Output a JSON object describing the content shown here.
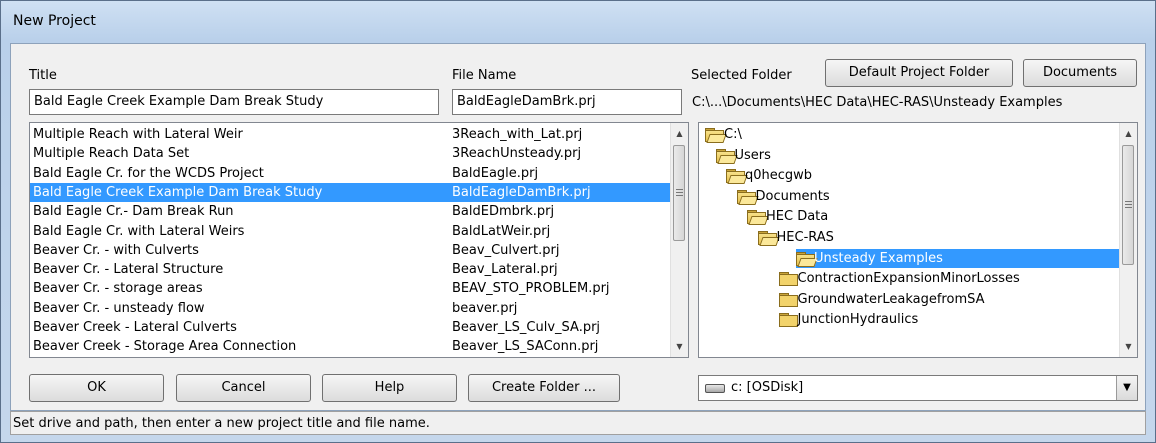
{
  "window": {
    "title": "New Project"
  },
  "labels": {
    "title": "Title",
    "file_name": "File Name",
    "selected_folder": "Selected Folder",
    "selected_folder_path": "C:\\...\\Documents\\HEC Data\\HEC-RAS\\Unsteady Examples"
  },
  "inputs": {
    "title_value": "Bald Eagle Creek Example Dam Break Study",
    "file_name_value": "BaldEagleDamBrk.prj"
  },
  "buttons": {
    "default_project_folder": "Default Project Folder",
    "documents": "Documents",
    "ok": "OK",
    "cancel": "Cancel",
    "help": "Help",
    "create_folder": "Create Folder ..."
  },
  "projects": [
    {
      "title": "Multiple Reach with Lateral Weir",
      "file": "3Reach_with_Lat.prj"
    },
    {
      "title": "Multiple Reach Data Set",
      "file": "3ReachUnsteady.prj"
    },
    {
      "title": "Bald Eagle Cr. for the WCDS Project",
      "file": "BaldEagle.prj"
    },
    {
      "title": "Bald Eagle Creek Example Dam Break Study",
      "file": "BaldEagleDamBrk.prj",
      "selected": true
    },
    {
      "title": "Bald Eagle Cr.- Dam Break Run",
      "file": "BaldEDmbrk.prj"
    },
    {
      "title": "Bald Eagle Cr. with Lateral Weirs",
      "file": "BaldLatWeir.prj"
    },
    {
      "title": "Beaver Cr. - with Culverts",
      "file": "Beav_Culvert.prj"
    },
    {
      "title": "Beaver Cr. - Lateral Structure",
      "file": "Beav_Lateral.prj"
    },
    {
      "title": "Beaver Cr. - storage areas",
      "file": "BEAV_STO_PROBLEM.prj"
    },
    {
      "title": "Beaver Cr. - unsteady flow",
      "file": "beaver.prj"
    },
    {
      "title": "Beaver Creek - Lateral Culverts",
      "file": "Beaver_LS_Culv_SA.prj"
    },
    {
      "title": "Beaver Creek - Storage Area Connection",
      "file": "Beaver_LS_SAConn.prj"
    }
  ],
  "folders": [
    {
      "name": "C:\\",
      "level": 0,
      "open": true
    },
    {
      "name": "Users",
      "level": 1,
      "open": true
    },
    {
      "name": "q0hecgwb",
      "level": 2,
      "open": true
    },
    {
      "name": "Documents",
      "level": 3,
      "open": true
    },
    {
      "name": "HEC Data",
      "level": 4,
      "open": true
    },
    {
      "name": "HEC-RAS",
      "level": 5,
      "open": true
    },
    {
      "name": "Unsteady Examples",
      "level": 6,
      "open": true,
      "selected": true
    },
    {
      "name": "ContractionExpansionMinorLosses",
      "level": 7,
      "open": false
    },
    {
      "name": "GroundwaterLeakagefromSA",
      "level": 7,
      "open": false
    },
    {
      "name": "JunctionHydraulics",
      "level": 7,
      "open": false
    }
  ],
  "drive": {
    "value": "c: [OSDisk]"
  },
  "status": {
    "text": "Set drive and path, then enter a new project title and file name."
  },
  "colors": {
    "selection": "#3399ff",
    "window_frame": "#b9d0ea"
  },
  "icons": {
    "folder": "folder-icon",
    "drive": "hard-drive-icon",
    "dropdown": "chevron-down-icon"
  }
}
